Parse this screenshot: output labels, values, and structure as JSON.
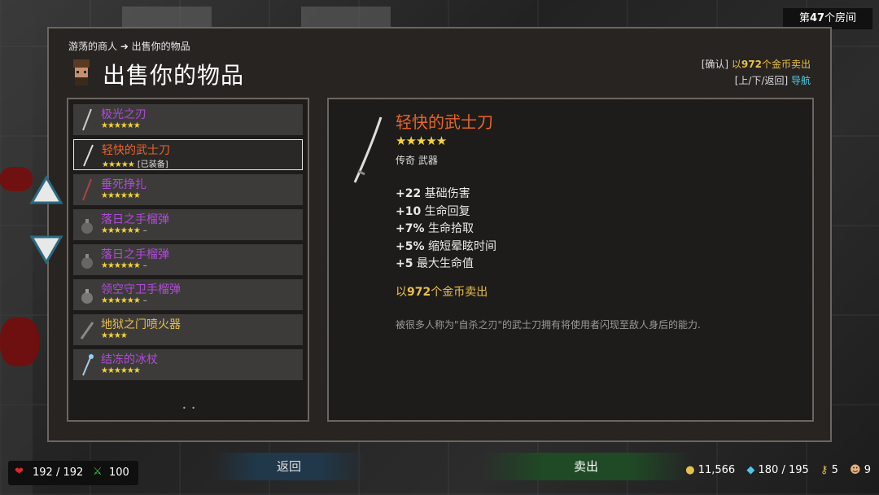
{
  "room": {
    "prefix": "第",
    "number": "47",
    "suffix": "个房间"
  },
  "breadcrumb": "游荡的商人 ➜ 出售你的物品",
  "title": "出售你的物品",
  "hints": {
    "line1_key": "[确认]",
    "line1_prefix": " 以",
    "line1_amount": "972",
    "line1_suffix": "个金币卖出",
    "line2_key": "[上/下/返回]",
    "line2_action": " 导航"
  },
  "items": [
    {
      "name": "极光之刃",
      "stars": "★★★★★★",
      "tag": "",
      "color": "purple"
    },
    {
      "name": "轻快的武士刀",
      "stars": "★★★★★",
      "tag": "[已装备]",
      "color": "orange"
    },
    {
      "name": "垂死挣扎",
      "stars": "★★★★★★",
      "tag": "",
      "color": "purple"
    },
    {
      "name": "落日之手榴弹",
      "stars": "★★★★★★",
      "tag": "–",
      "color": "purple"
    },
    {
      "name": "落日之手榴弹",
      "stars": "★★★★★★",
      "tag": "–",
      "color": "purple"
    },
    {
      "name": "领空守卫手榴弹",
      "stars": "★★★★★★",
      "tag": "–",
      "color": "purple"
    },
    {
      "name": "地狱之门喷火器",
      "stars": "★★★★",
      "tag": "",
      "color": "yellow"
    },
    {
      "name": "结冻的冰杖",
      "stars": "★★★★★★",
      "tag": "",
      "color": "purple"
    }
  ],
  "pager": "• •",
  "detail": {
    "name": "轻快的武士刀",
    "stars": "★★★★★",
    "type": "传奇 武器",
    "stats": [
      {
        "value": "+22",
        "label": "基础伤害"
      },
      {
        "value": "+10",
        "label": "生命回复"
      },
      {
        "value": "+7%",
        "label": "生命拾取"
      },
      {
        "value": "+5%",
        "label": "缩短晕眩时间"
      },
      {
        "value": "+5",
        "label": "最大生命值"
      }
    ],
    "sell_prefix": "以",
    "sell_amount": "972",
    "sell_suffix": "个金币卖出",
    "description": "被很多人称为\"自杀之刃\"的武士刀拥有将使用者闪现至敌人身后的能力."
  },
  "buttons": {
    "back": "返回",
    "sell": "卖出"
  },
  "hud": {
    "health": "192 / 192",
    "attack": "100",
    "gold": "11,566",
    "gems": "180 / 195",
    "keys": "5",
    "pets": "9"
  }
}
